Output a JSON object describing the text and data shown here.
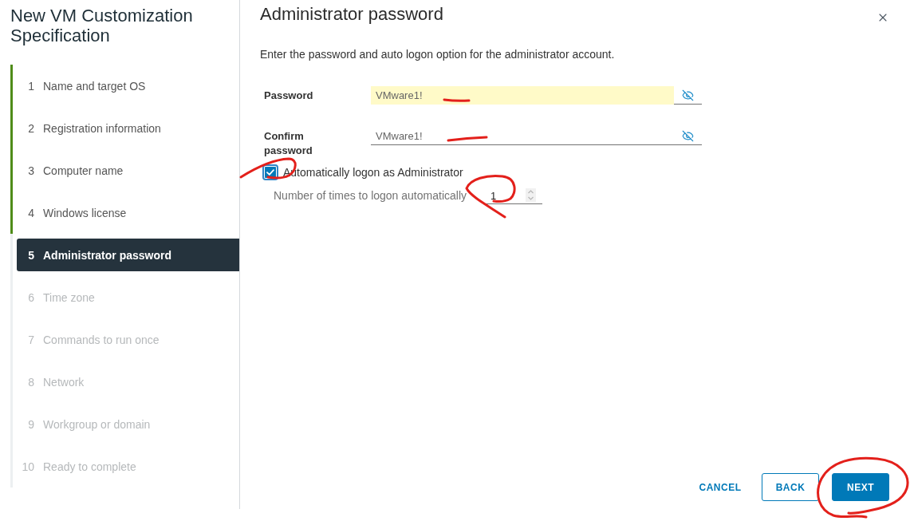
{
  "sidebar": {
    "title": "New VM Customization Specification",
    "steps": [
      {
        "number": "1",
        "label": "Name and target OS",
        "completed": true,
        "selected": false,
        "disabled": false
      },
      {
        "number": "2",
        "label": "Registration information",
        "completed": true,
        "selected": false,
        "disabled": false
      },
      {
        "number": "3",
        "label": "Computer name",
        "completed": true,
        "selected": false,
        "disabled": false
      },
      {
        "number": "4",
        "label": "Windows license",
        "completed": true,
        "selected": false,
        "disabled": false
      },
      {
        "number": "5",
        "label": "Administrator password",
        "completed": false,
        "selected": true,
        "disabled": false
      },
      {
        "number": "6",
        "label": "Time zone",
        "completed": false,
        "selected": false,
        "disabled": true
      },
      {
        "number": "7",
        "label": "Commands to run once",
        "completed": false,
        "selected": false,
        "disabled": true
      },
      {
        "number": "8",
        "label": "Network",
        "completed": false,
        "selected": false,
        "disabled": true
      },
      {
        "number": "9",
        "label": "Workgroup or domain",
        "completed": false,
        "selected": false,
        "disabled": true
      },
      {
        "number": "10",
        "label": "Ready to complete",
        "completed": false,
        "selected": false,
        "disabled": true
      }
    ]
  },
  "panel": {
    "title": "Administrator password",
    "description": "Enter the password and auto logon option for the administrator account.",
    "fields": [
      {
        "label": "Password",
        "value": "VMware1!",
        "revealed": true,
        "autofilled": true
      },
      {
        "label": "Confirm password",
        "value": "VMware1!",
        "revealed": true,
        "autofilled": false
      }
    ],
    "auto_logon": {
      "label": "Automatically logon as Administrator",
      "checked": true
    },
    "logon_count": {
      "label": "Number of times to logon automatically",
      "value": "1"
    }
  },
  "buttons": [
    {
      "label": "CANCEL",
      "kind": "flat"
    },
    {
      "label": "BACK",
      "kind": "outline"
    },
    {
      "label": "NEXT",
      "kind": "primary"
    }
  ]
}
